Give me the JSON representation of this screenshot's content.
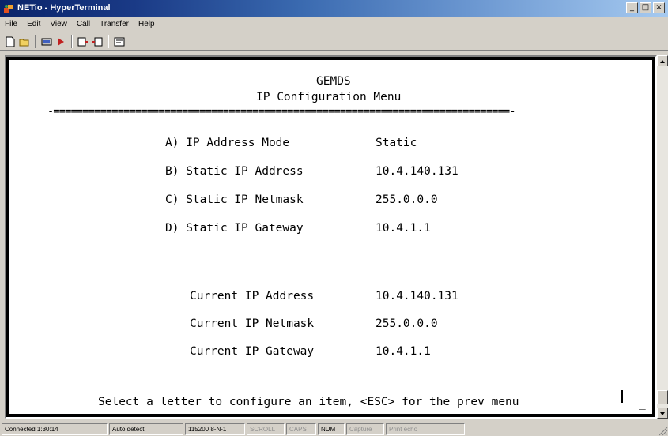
{
  "window": {
    "title": "NETio - HyperTerminal",
    "buttons": [
      "_",
      "□",
      "×"
    ]
  },
  "menu": [
    "File",
    "Edit",
    "View",
    "Call",
    "Transfer",
    "Help"
  ],
  "toolbar": {
    "icons": [
      "new-icon",
      "open-icon",
      "disconnect-icon",
      "properties-call-icon",
      "send-icon",
      "receive-icon",
      "properties-icon"
    ]
  },
  "terminal": {
    "brand": "GEMDS",
    "title": "IP Configuration Menu",
    "separator": "-==============================================================================-",
    "options": [
      {
        "label": "A) IP Address Mode",
        "value": "Static"
      },
      {
        "label": "B) Static IP Address",
        "value": "10.4.140.131"
      },
      {
        "label": "C) Static IP Netmask",
        "value": "255.0.0.0"
      },
      {
        "label": "D) Static IP Gateway",
        "value": "10.4.1.1"
      }
    ],
    "current": [
      {
        "label": "Current IP Address",
        "value": "10.4.140.131"
      },
      {
        "label": "Current IP Netmask",
        "value": "255.0.0.0"
      },
      {
        "label": "Current IP Gateway",
        "value": "10.4.1.1"
      }
    ],
    "prompt": "Select a letter to configure an item, <ESC> for the prev menu",
    "cursor_char": "_"
  },
  "status": {
    "connected": "Connected 1:30:14",
    "detect": "Auto detect",
    "settings": "115200 8-N-1",
    "scroll": "SCROLL",
    "caps": "CAPS",
    "num": "NUM",
    "capture": "Capture",
    "printecho": "Print echo"
  }
}
